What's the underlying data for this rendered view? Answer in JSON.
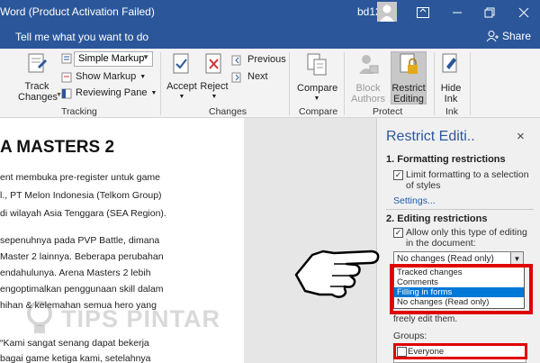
{
  "window": {
    "title": "Word (Product Activation Failed)",
    "user": "bd12"
  },
  "tellbar": {
    "tell_me": "Tell me what you want to do",
    "share": "Share"
  },
  "ribbon": {
    "track_changes": [
      "Track",
      "Changes"
    ],
    "markup_dropdown": "Simple Markup",
    "show_markup": "Show Markup",
    "reviewing_pane": "Reviewing Pane",
    "tracking_label": "Tracking",
    "accept": "Accept",
    "reject": "Reject",
    "previous": "Previous",
    "next": "Next",
    "changes_label": "Changes",
    "compare": "Compare",
    "compare_label": "Compare",
    "block_authors": [
      "Block",
      "Authors"
    ],
    "restrict_editing": [
      "Restrict",
      "Editing"
    ],
    "protect_label": "Protect",
    "hide_ink": [
      "Hide",
      "Ink"
    ],
    "ink_label": "Ink"
  },
  "document": {
    "heading": "A MASTERS 2",
    "lines": [
      "ent membuka pre-register untuk game",
      "l., PT Melon Indonesia (Telkom Group)",
      "di wilayah Asia Tenggara (SEA Region).",
      "",
      "sepenuhnya pada PVP Battle, dimana",
      "Master 2 lainnya. Beberapa perubahan",
      "endahulunya. Arena Masters 2 lebih",
      "engoptimalkan penggunaan skill dalam",
      "hihan & kelemahan semua hero yang",
      "",
      "",
      "“Kami sangat senang dapat bekerja",
      "bagai game ketiga kami, setelahnya"
    ],
    "watermark": "TIPS PINTAR"
  },
  "pane": {
    "title": "Restrict Editi..",
    "close": "×",
    "sec1": "1. Formatting restrictions",
    "limit_formatting": [
      "Limit formatting to a selection",
      "of styles"
    ],
    "settings_link": "Settings...",
    "sec2": "2. Editing restrictions",
    "allow_only": [
      "Allow only this type of editing",
      "in the document:"
    ],
    "select_value": "No changes (Read only)",
    "options": [
      "Tracked changes",
      "Comments",
      "Filling in forms",
      "No changes (Read only)"
    ],
    "selected_option": "Filling in forms",
    "freely_edit": "freely edit them.",
    "groups_label": "Groups:",
    "group_everyone": "Everyone"
  },
  "colors": {
    "word_blue": "#2b579a",
    "highlight": "#e00000",
    "selection": "#0078d7"
  }
}
